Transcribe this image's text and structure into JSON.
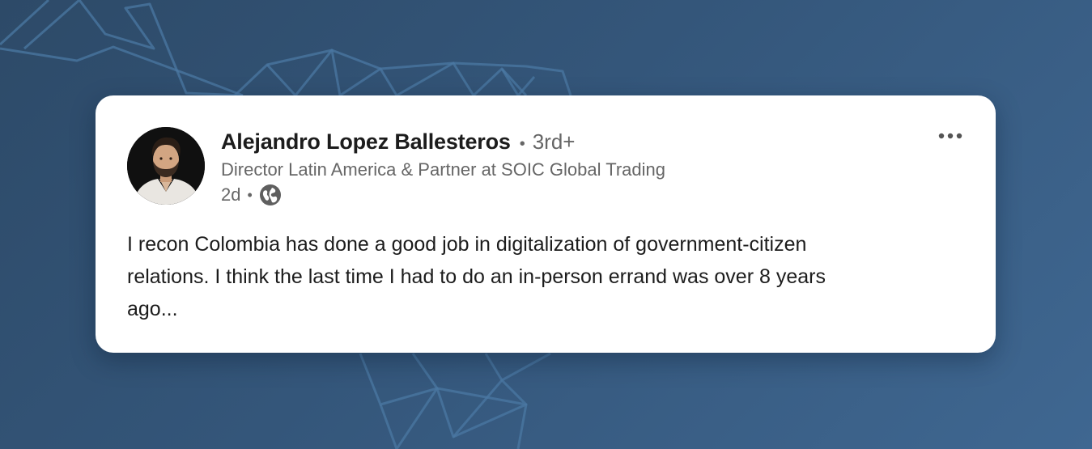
{
  "post": {
    "author": {
      "name": "Alejandro Lopez Ballesteros",
      "degree": "3rd+",
      "headline": "Director Latin America & Partner at SOIC Global Trading",
      "avatar": "profile-photo"
    },
    "meta": {
      "time": "2d",
      "visibility_icon": "globe-icon"
    },
    "menu_icon": "more-horizontal-icon",
    "body_lines": [
      "I recon Colombia has done a good job in digitalization of government-citizen",
      "relations. I think the last time I had to do an in-person errand was over 8 years",
      "ago..."
    ]
  },
  "colors": {
    "background_top": "#2d4a68",
    "background_bottom": "#3f6791",
    "pattern_stroke": "#4b78a3",
    "card_background": "#ffffff",
    "text_primary": "#1c1c1c",
    "text_secondary": "#666666"
  }
}
